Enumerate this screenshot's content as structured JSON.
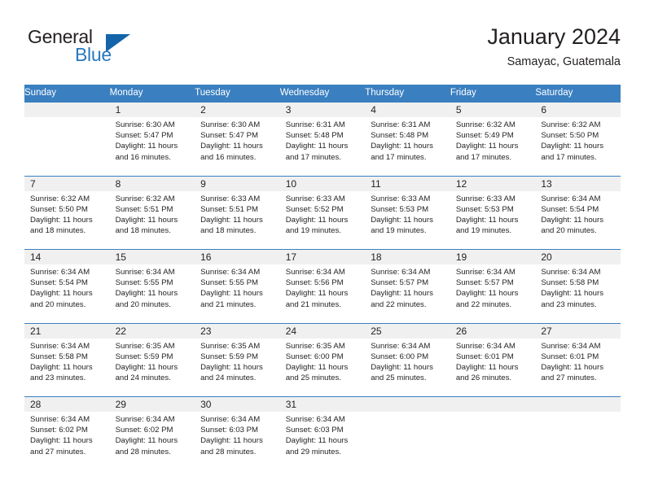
{
  "logo": {
    "word1": "General",
    "word2": "Blue",
    "triangle_color": "#1464aa",
    "blue_color": "#2878be"
  },
  "header": {
    "title": "January 2024",
    "subtitle": "Samayac, Guatemala"
  },
  "theme": {
    "header_blue": "#3a7fc0",
    "daynum_band": "#f0f0f0",
    "text": "#231f20"
  },
  "calendar": {
    "weekday_headers": [
      "Sunday",
      "Monday",
      "Tuesday",
      "Wednesday",
      "Thursday",
      "Friday",
      "Saturday"
    ],
    "weeks": [
      {
        "days": [
          {
            "num": "",
            "sunrise": "",
            "sunset": "",
            "daylight_line1": "",
            "daylight_line2": ""
          },
          {
            "num": "1",
            "sunrise": "Sunrise: 6:30 AM",
            "sunset": "Sunset: 5:47 PM",
            "daylight_line1": "Daylight: 11 hours",
            "daylight_line2": "and 16 minutes."
          },
          {
            "num": "2",
            "sunrise": "Sunrise: 6:30 AM",
            "sunset": "Sunset: 5:47 PM",
            "daylight_line1": "Daylight: 11 hours",
            "daylight_line2": "and 16 minutes."
          },
          {
            "num": "3",
            "sunrise": "Sunrise: 6:31 AM",
            "sunset": "Sunset: 5:48 PM",
            "daylight_line1": "Daylight: 11 hours",
            "daylight_line2": "and 17 minutes."
          },
          {
            "num": "4",
            "sunrise": "Sunrise: 6:31 AM",
            "sunset": "Sunset: 5:48 PM",
            "daylight_line1": "Daylight: 11 hours",
            "daylight_line2": "and 17 minutes."
          },
          {
            "num": "5",
            "sunrise": "Sunrise: 6:32 AM",
            "sunset": "Sunset: 5:49 PM",
            "daylight_line1": "Daylight: 11 hours",
            "daylight_line2": "and 17 minutes."
          },
          {
            "num": "6",
            "sunrise": "Sunrise: 6:32 AM",
            "sunset": "Sunset: 5:50 PM",
            "daylight_line1": "Daylight: 11 hours",
            "daylight_line2": "and 17 minutes."
          }
        ]
      },
      {
        "days": [
          {
            "num": "7",
            "sunrise": "Sunrise: 6:32 AM",
            "sunset": "Sunset: 5:50 PM",
            "daylight_line1": "Daylight: 11 hours",
            "daylight_line2": "and 18 minutes."
          },
          {
            "num": "8",
            "sunrise": "Sunrise: 6:32 AM",
            "sunset": "Sunset: 5:51 PM",
            "daylight_line1": "Daylight: 11 hours",
            "daylight_line2": "and 18 minutes."
          },
          {
            "num": "9",
            "sunrise": "Sunrise: 6:33 AM",
            "sunset": "Sunset: 5:51 PM",
            "daylight_line1": "Daylight: 11 hours",
            "daylight_line2": "and 18 minutes."
          },
          {
            "num": "10",
            "sunrise": "Sunrise: 6:33 AM",
            "sunset": "Sunset: 5:52 PM",
            "daylight_line1": "Daylight: 11 hours",
            "daylight_line2": "and 19 minutes."
          },
          {
            "num": "11",
            "sunrise": "Sunrise: 6:33 AM",
            "sunset": "Sunset: 5:53 PM",
            "daylight_line1": "Daylight: 11 hours",
            "daylight_line2": "and 19 minutes."
          },
          {
            "num": "12",
            "sunrise": "Sunrise: 6:33 AM",
            "sunset": "Sunset: 5:53 PM",
            "daylight_line1": "Daylight: 11 hours",
            "daylight_line2": "and 19 minutes."
          },
          {
            "num": "13",
            "sunrise": "Sunrise: 6:34 AM",
            "sunset": "Sunset: 5:54 PM",
            "daylight_line1": "Daylight: 11 hours",
            "daylight_line2": "and 20 minutes."
          }
        ]
      },
      {
        "days": [
          {
            "num": "14",
            "sunrise": "Sunrise: 6:34 AM",
            "sunset": "Sunset: 5:54 PM",
            "daylight_line1": "Daylight: 11 hours",
            "daylight_line2": "and 20 minutes."
          },
          {
            "num": "15",
            "sunrise": "Sunrise: 6:34 AM",
            "sunset": "Sunset: 5:55 PM",
            "daylight_line1": "Daylight: 11 hours",
            "daylight_line2": "and 20 minutes."
          },
          {
            "num": "16",
            "sunrise": "Sunrise: 6:34 AM",
            "sunset": "Sunset: 5:55 PM",
            "daylight_line1": "Daylight: 11 hours",
            "daylight_line2": "and 21 minutes."
          },
          {
            "num": "17",
            "sunrise": "Sunrise: 6:34 AM",
            "sunset": "Sunset: 5:56 PM",
            "daylight_line1": "Daylight: 11 hours",
            "daylight_line2": "and 21 minutes."
          },
          {
            "num": "18",
            "sunrise": "Sunrise: 6:34 AM",
            "sunset": "Sunset: 5:57 PM",
            "daylight_line1": "Daylight: 11 hours",
            "daylight_line2": "and 22 minutes."
          },
          {
            "num": "19",
            "sunrise": "Sunrise: 6:34 AM",
            "sunset": "Sunset: 5:57 PM",
            "daylight_line1": "Daylight: 11 hours",
            "daylight_line2": "and 22 minutes."
          },
          {
            "num": "20",
            "sunrise": "Sunrise: 6:34 AM",
            "sunset": "Sunset: 5:58 PM",
            "daylight_line1": "Daylight: 11 hours",
            "daylight_line2": "and 23 minutes."
          }
        ]
      },
      {
        "days": [
          {
            "num": "21",
            "sunrise": "Sunrise: 6:34 AM",
            "sunset": "Sunset: 5:58 PM",
            "daylight_line1": "Daylight: 11 hours",
            "daylight_line2": "and 23 minutes."
          },
          {
            "num": "22",
            "sunrise": "Sunrise: 6:35 AM",
            "sunset": "Sunset: 5:59 PM",
            "daylight_line1": "Daylight: 11 hours",
            "daylight_line2": "and 24 minutes."
          },
          {
            "num": "23",
            "sunrise": "Sunrise: 6:35 AM",
            "sunset": "Sunset: 5:59 PM",
            "daylight_line1": "Daylight: 11 hours",
            "daylight_line2": "and 24 minutes."
          },
          {
            "num": "24",
            "sunrise": "Sunrise: 6:35 AM",
            "sunset": "Sunset: 6:00 PM",
            "daylight_line1": "Daylight: 11 hours",
            "daylight_line2": "and 25 minutes."
          },
          {
            "num": "25",
            "sunrise": "Sunrise: 6:34 AM",
            "sunset": "Sunset: 6:00 PM",
            "daylight_line1": "Daylight: 11 hours",
            "daylight_line2": "and 25 minutes."
          },
          {
            "num": "26",
            "sunrise": "Sunrise: 6:34 AM",
            "sunset": "Sunset: 6:01 PM",
            "daylight_line1": "Daylight: 11 hours",
            "daylight_line2": "and 26 minutes."
          },
          {
            "num": "27",
            "sunrise": "Sunrise: 6:34 AM",
            "sunset": "Sunset: 6:01 PM",
            "daylight_line1": "Daylight: 11 hours",
            "daylight_line2": "and 27 minutes."
          }
        ]
      },
      {
        "days": [
          {
            "num": "28",
            "sunrise": "Sunrise: 6:34 AM",
            "sunset": "Sunset: 6:02 PM",
            "daylight_line1": "Daylight: 11 hours",
            "daylight_line2": "and 27 minutes."
          },
          {
            "num": "29",
            "sunrise": "Sunrise: 6:34 AM",
            "sunset": "Sunset: 6:02 PM",
            "daylight_line1": "Daylight: 11 hours",
            "daylight_line2": "and 28 minutes."
          },
          {
            "num": "30",
            "sunrise": "Sunrise: 6:34 AM",
            "sunset": "Sunset: 6:03 PM",
            "daylight_line1": "Daylight: 11 hours",
            "daylight_line2": "and 28 minutes."
          },
          {
            "num": "31",
            "sunrise": "Sunrise: 6:34 AM",
            "sunset": "Sunset: 6:03 PM",
            "daylight_line1": "Daylight: 11 hours",
            "daylight_line2": "and 29 minutes."
          },
          {
            "num": "",
            "sunrise": "",
            "sunset": "",
            "daylight_line1": "",
            "daylight_line2": ""
          },
          {
            "num": "",
            "sunrise": "",
            "sunset": "",
            "daylight_line1": "",
            "daylight_line2": ""
          },
          {
            "num": "",
            "sunrise": "",
            "sunset": "",
            "daylight_line1": "",
            "daylight_line2": ""
          }
        ]
      }
    ]
  }
}
